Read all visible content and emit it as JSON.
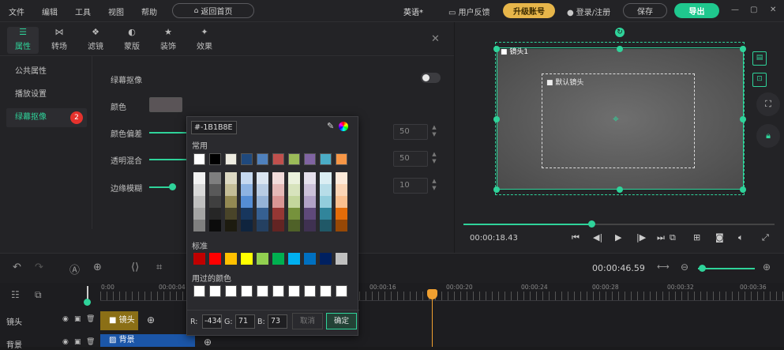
{
  "menubar": {
    "menus": [
      "文件",
      "编辑",
      "工具",
      "视图",
      "帮助"
    ],
    "back_home": "返回首页",
    "project_title": "英语*",
    "feedback": "用户反馈",
    "upgrade": "升级账号",
    "login": "登录/注册",
    "save": "保存",
    "export": "导出"
  },
  "prop_tabs": [
    "属性",
    "转场",
    "滤镜",
    "蒙版",
    "装饰",
    "效果"
  ],
  "sidebar": {
    "items": [
      "公共属性",
      "播放设置",
      "绿幕抠像"
    ],
    "badge": "2"
  },
  "green_screen": {
    "title": "绿幕抠像",
    "color_label": "颜色",
    "color_value": "#5a5457",
    "color_offset_label": "颜色偏差",
    "color_offset_value": "50",
    "transparency_label": "透明混合",
    "transparency_value": "50",
    "edge_blur_label": "边缘模糊",
    "edge_blur_value": "10",
    "toggle_on": false
  },
  "picker": {
    "hex_value": "#-1B1B8E",
    "common_label": "常用",
    "standard_label": "标准",
    "used_label": "用过的颜色",
    "common_top": [
      "#ffffff",
      "#000000",
      "#eeece1",
      "#1f497d",
      "#4f81bd",
      "#c0504d",
      "#9bbb59",
      "#8064a2",
      "#4bacc6",
      "#f79646"
    ],
    "common_grid": [
      [
        "#f2f2f2",
        "#7f7f7f",
        "#ddd9c3",
        "#c6d9f0",
        "#dbe5f1",
        "#f2dcdb",
        "#ebf1dd",
        "#e5e0ec",
        "#dbeef3",
        "#fdeada"
      ],
      [
        "#d8d8d8",
        "#595959",
        "#c4bd97",
        "#8db3e2",
        "#b8cce4",
        "#e5b9b7",
        "#d7e3bc",
        "#ccc1d9",
        "#b7dde8",
        "#fbd5b5"
      ],
      [
        "#bfbfbf",
        "#3f3f3f",
        "#938953",
        "#548dd4",
        "#95b3d7",
        "#d99694",
        "#c3d69b",
        "#b2a2c7",
        "#92cddc",
        "#fac08f"
      ],
      [
        "#a5a5a5",
        "#262626",
        "#494429",
        "#17365d",
        "#366092",
        "#953734",
        "#76923c",
        "#5f497a",
        "#31859b",
        "#e36c09"
      ],
      [
        "#7f7f7f",
        "#0c0c0c",
        "#1d1b10",
        "#0f243e",
        "#244061",
        "#632423",
        "#4f6128",
        "#3f3151",
        "#205867",
        "#974806"
      ]
    ],
    "standard": [
      "#c00000",
      "#ff0000",
      "#ffc000",
      "#ffff00",
      "#92d050",
      "#00b050",
      "#00b0f0",
      "#0070c0",
      "#002060",
      "#c0c0c0"
    ],
    "used": [
      "#ffffff",
      "#ffffff",
      "#ffffff",
      "#ffffff",
      "#ffffff",
      "#ffffff",
      "#ffffff",
      "#ffffff",
      "#ffffff",
      "#ffffff"
    ],
    "r_label": "R:",
    "r_value": "-434",
    "g_label": "G:",
    "g_value": "71",
    "b_label": "B:",
    "b_value": "73",
    "cancel": "取消",
    "confirm": "确定"
  },
  "preview": {
    "lens1_label": "镜头1",
    "default_lens_label": "默认镜头",
    "current_time": "00:00:18.43",
    "progress_fraction": 0.41
  },
  "timeline": {
    "total_time": "00:00:46.59",
    "ruler": [
      "0:00",
      "00:00:04",
      "00:00:16",
      "00:00:20",
      "00:00:24",
      "00:00:28",
      "00:00:32",
      "00:00:36"
    ],
    "tracks": [
      {
        "name": "镜头",
        "clip": "镜头"
      },
      {
        "name": "背景",
        "clip": "背景"
      }
    ]
  },
  "colors": {
    "accent": "#2fd39a",
    "upgrade": "#e7b64a",
    "badge": "#e5322d"
  }
}
